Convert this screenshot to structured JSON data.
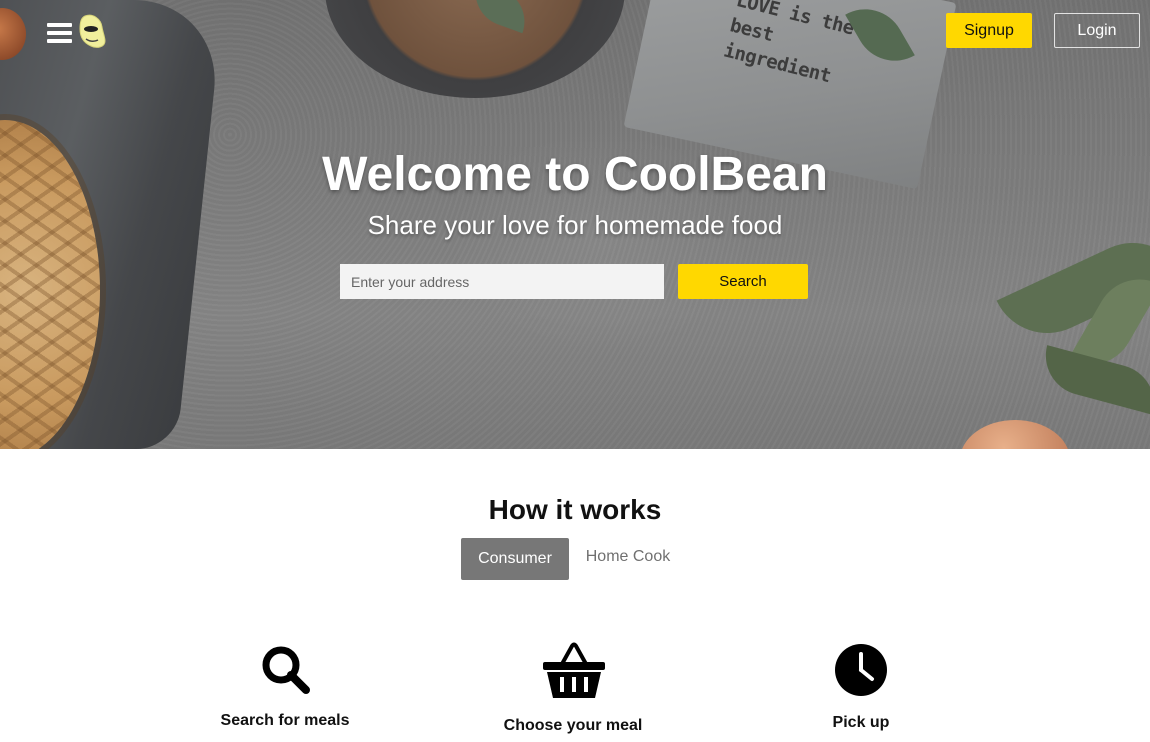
{
  "nav": {
    "menu_icon": "hamburger-menu-icon",
    "logo_icon": "bean-logo-icon",
    "signup_label": "Signup",
    "login_label": "Login"
  },
  "hero": {
    "title": "Welcome to CoolBean",
    "subtitle": "Share your love for homemade food",
    "address_placeholder": "Enter your address",
    "address_value": "",
    "search_label": "Search",
    "napkin_text_line1": "LOVE is the",
    "napkin_text_line2": "best ingredient"
  },
  "how_it_works": {
    "title": "How it works",
    "tabs": [
      {
        "label": "Consumer",
        "active": true
      },
      {
        "label": "Home Cook",
        "active": false
      }
    ],
    "steps": [
      {
        "icon": "magnifier-icon",
        "label": "Search for meals"
      },
      {
        "icon": "basket-icon",
        "label": "Choose your meal"
      },
      {
        "icon": "clock-icon",
        "label": "Pick up"
      }
    ]
  },
  "colors": {
    "accent": "#ffd800",
    "active_tab": "#777777",
    "inactive_tab_text": "#707070"
  }
}
